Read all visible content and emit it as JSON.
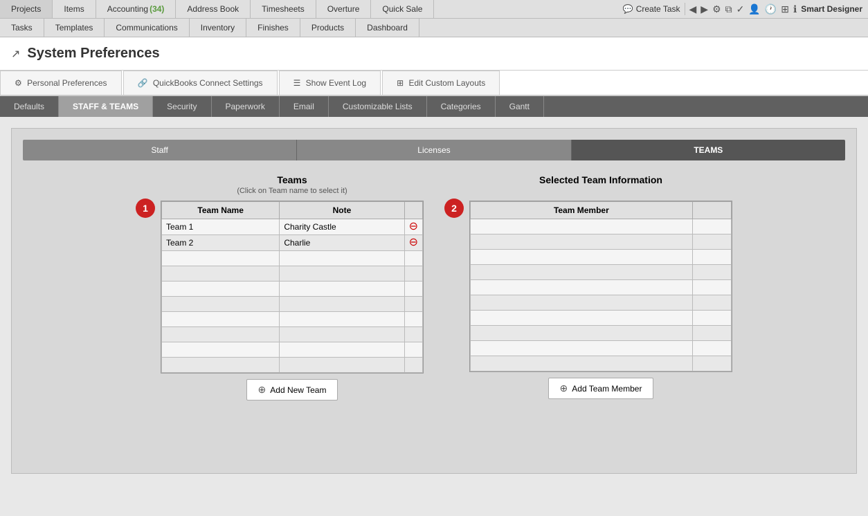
{
  "nav": {
    "row1": [
      {
        "id": "projects",
        "label": "Projects"
      },
      {
        "id": "items",
        "label": "Items"
      },
      {
        "id": "accounting",
        "label": "Accounting",
        "badge": "(34)"
      },
      {
        "id": "address-book",
        "label": "Address Book"
      },
      {
        "id": "timesheets",
        "label": "Timesheets"
      },
      {
        "id": "overture",
        "label": "Overture"
      },
      {
        "id": "quick-sale",
        "label": "Quick Sale"
      }
    ],
    "row2": [
      {
        "id": "tasks",
        "label": "Tasks"
      },
      {
        "id": "templates",
        "label": "Templates"
      },
      {
        "id": "communications",
        "label": "Communications"
      },
      {
        "id": "inventory",
        "label": "Inventory"
      },
      {
        "id": "finishes",
        "label": "Finishes"
      },
      {
        "id": "products",
        "label": "Products"
      },
      {
        "id": "dashboard",
        "label": "Dashboard"
      }
    ],
    "create_task": "Create Task",
    "smart_designer": "Smart Designer"
  },
  "page": {
    "title": "System Preferences"
  },
  "main_tabs": [
    {
      "id": "personal-prefs",
      "label": "Personal Preferences",
      "icon": "⚙"
    },
    {
      "id": "quickbooks",
      "label": "QuickBooks Connect Settings",
      "icon": "🔗"
    },
    {
      "id": "event-log",
      "label": "Show Event Log",
      "icon": "☰"
    },
    {
      "id": "custom-layouts",
      "label": "Edit Custom Layouts",
      "icon": "⊞"
    }
  ],
  "secondary_tabs": [
    {
      "id": "defaults",
      "label": "Defaults"
    },
    {
      "id": "staff-teams",
      "label": "STAFF & TEAMS",
      "active": true
    },
    {
      "id": "security",
      "label": "Security"
    },
    {
      "id": "paperwork",
      "label": "Paperwork"
    },
    {
      "id": "email",
      "label": "Email"
    },
    {
      "id": "customizable-lists",
      "label": "Customizable Lists"
    },
    {
      "id": "categories",
      "label": "Categories"
    },
    {
      "id": "gantt",
      "label": "Gantt"
    }
  ],
  "sub_tabs": [
    {
      "id": "staff",
      "label": "Staff"
    },
    {
      "id": "licenses",
      "label": "Licenses"
    },
    {
      "id": "teams",
      "label": "TEAMS",
      "active": true
    }
  ],
  "teams_section": {
    "title": "Teams",
    "subtitle": "(Click on Team name to select it)",
    "columns": [
      {
        "id": "team-name",
        "label": "Team Name"
      },
      {
        "id": "note",
        "label": "Note"
      }
    ],
    "rows": [
      {
        "team_name": "Team 1",
        "note": "Charity Castle"
      },
      {
        "team_name": "Team 2",
        "note": "Charlie"
      }
    ],
    "empty_rows": 8,
    "add_btn_label": "Add New Team",
    "badge_number": "1"
  },
  "selected_section": {
    "title": "Selected Team Information",
    "columns": [
      {
        "id": "team-member",
        "label": "Team Member"
      },
      {
        "id": "member-note",
        "label": ""
      }
    ],
    "rows": [],
    "empty_rows": 10,
    "add_btn_label": "Add Team Member",
    "badge_number": "2"
  }
}
